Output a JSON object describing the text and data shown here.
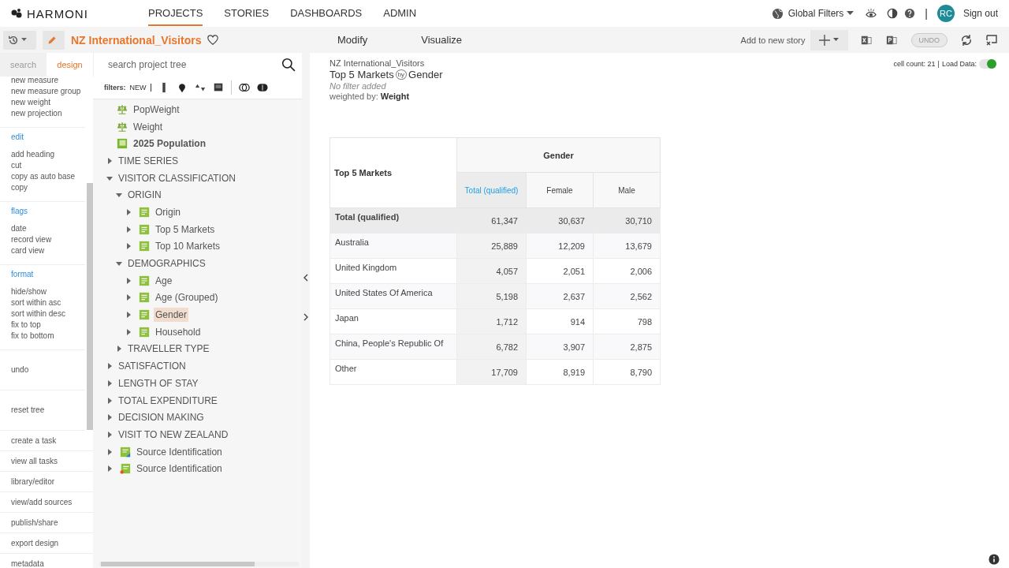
{
  "header": {
    "logo": "HARMONI",
    "nav": [
      {
        "label": "PROJECTS",
        "selected": true
      },
      {
        "label": "STORIES",
        "selected": false
      },
      {
        "label": "DASHBOARDS",
        "selected": false
      },
      {
        "label": "ADMIN",
        "selected": false
      }
    ],
    "global_filters": "Global Filters",
    "separator": "|",
    "avatar": "RC",
    "sign_out": "Sign out"
  },
  "project_bar": {
    "title": "NZ International_Visitors"
  },
  "left_tabs": [
    {
      "label": "search",
      "selected": false
    },
    {
      "label": "design",
      "selected": true
    }
  ],
  "tree_search": {
    "placeholder": "search project tree"
  },
  "filters": {
    "label": "filters:",
    "new": "NEW"
  },
  "menu": [
    {
      "items": [
        "new measure",
        "new measure group",
        "new weight",
        "new projection"
      ]
    },
    {
      "heading": "edit",
      "items": [
        "add heading",
        "cut",
        "copy as auto base",
        "copy"
      ]
    },
    {
      "heading": "flags",
      "items": [
        "date",
        "record view",
        "card view"
      ]
    },
    {
      "heading": "format",
      "items": [
        "hide/show",
        "sort within asc",
        "sort within desc",
        "fix to top",
        "fix to bottom"
      ]
    },
    {
      "items": [
        "undo"
      ]
    },
    {
      "items": [
        "reset tree"
      ]
    }
  ],
  "task_menu": [
    "create a task",
    "view all tasks",
    "library/editor",
    "view/add sources",
    "publish/share",
    "export design",
    "metadata"
  ],
  "tree": [
    {
      "label": "PopWeight",
      "kind": "weight",
      "selected": false
    },
    {
      "label": "Weight",
      "kind": "weight",
      "selected": false
    },
    {
      "label": "2025 Population",
      "kind": "numeric",
      "selected": false
    },
    {
      "label": "TIME SERIES",
      "kind": "folder",
      "expanded": false,
      "selected": false
    },
    {
      "label": "VISITOR CLASSIFICATION",
      "kind": "folder",
      "expanded": true,
      "selected": false,
      "children": [
        {
          "label": "ORIGIN",
          "kind": "folder",
          "expanded": true,
          "selected": false,
          "children": [
            {
              "label": "Origin",
              "kind": "category",
              "expanded": false,
              "selected": false
            },
            {
              "label": "Top 5 Markets",
              "kind": "category",
              "expanded": false,
              "selected": false
            },
            {
              "label": "Top 10 Markets",
              "kind": "category",
              "expanded": false,
              "selected": false
            }
          ]
        },
        {
          "label": "DEMOGRAPHICS",
          "kind": "folder",
          "expanded": true,
          "selected": false,
          "children": [
            {
              "label": "Age",
              "kind": "category",
              "expanded": false,
              "selected": false
            },
            {
              "label": "Age (Grouped)",
              "kind": "category",
              "expanded": false,
              "selected": false
            },
            {
              "label": "Gender",
              "kind": "category",
              "expanded": false,
              "selected": true
            },
            {
              "label": "Household",
              "kind": "category",
              "expanded": false,
              "selected": false
            }
          ]
        },
        {
          "label": "TRAVELLER TYPE",
          "kind": "folder",
          "expanded": false,
          "selected": false
        }
      ]
    },
    {
      "label": "SATISFACTION",
      "kind": "folder",
      "expanded": false,
      "selected": false
    },
    {
      "label": "LENGTH OF STAY",
      "kind": "folder",
      "expanded": false,
      "selected": false
    },
    {
      "label": "TOTAL EXPENDITURE",
      "kind": "folder",
      "expanded": false,
      "selected": false
    },
    {
      "label": "DECISION MAKING",
      "kind": "folder",
      "expanded": false,
      "selected": false
    },
    {
      "label": "VISIT TO NEW ZEALAND",
      "kind": "folder",
      "expanded": false,
      "selected": false
    },
    {
      "label": "Source Identification",
      "kind": "source-edit",
      "expanded": false,
      "selected": false
    },
    {
      "label": "Source Identification",
      "kind": "source-flag",
      "expanded": false,
      "selected": false
    }
  ],
  "report_bar": {
    "tabs": [
      "Modify",
      "Visualize"
    ],
    "add_story": "Add to new story",
    "undo": {
      "label": "UNDO",
      "disabled": true
    }
  },
  "report": {
    "project": "NZ International_Visitors",
    "row_var": "Top 5 Markets",
    "by": "by",
    "col_var": "Gender",
    "filter": "No filter added",
    "weight_label": "weighted by:",
    "weight": "Weight",
    "cell_count": "cell count: 21",
    "divider": "|",
    "load_data": "Load Data:",
    "load_on": true
  },
  "table": {
    "corner": "Top 5 Markets",
    "group": "Gender",
    "columns": [
      {
        "label": "Total (qualified)",
        "selected": true
      },
      {
        "label": "Female",
        "selected": false
      },
      {
        "label": "Male",
        "selected": false
      }
    ],
    "rows": [
      {
        "label": "Total (qualified)",
        "kind": "total",
        "cells": [
          "61,347",
          "30,637",
          "30,710"
        ]
      },
      {
        "label": "Australia",
        "kind": "data",
        "cells": [
          "25,889",
          "12,209",
          "13,679"
        ]
      },
      {
        "label": "United Kingdom",
        "kind": "data",
        "cells": [
          "4,057",
          "2,051",
          "2,006"
        ]
      },
      {
        "label": "United States Of America",
        "kind": "data",
        "cells": [
          "5,198",
          "2,637",
          "2,562"
        ]
      },
      {
        "label": "Japan",
        "kind": "data",
        "cells": [
          "1,712",
          "914",
          "798"
        ]
      },
      {
        "label": "China, People's Republic Of",
        "kind": "data",
        "cells": [
          "6,782",
          "3,907",
          "2,875"
        ]
      },
      {
        "label": "Other",
        "kind": "data",
        "cells": [
          "17,709",
          "8,919",
          "8,790"
        ]
      }
    ]
  }
}
